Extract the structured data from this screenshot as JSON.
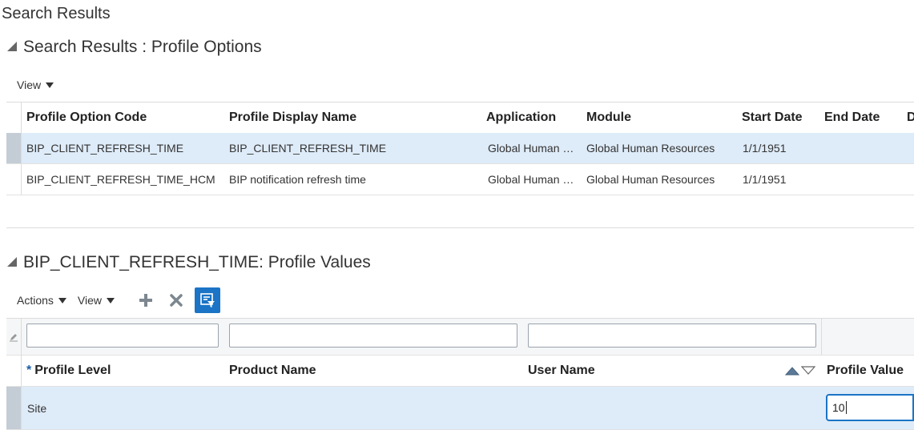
{
  "page": {
    "title": "Search Results"
  },
  "profile_options": {
    "section_title": "Search Results : Profile Options",
    "toolbar": {
      "view_label": "View"
    },
    "columns": [
      "Profile Option Code",
      "Profile Display Name",
      "Application",
      "Module",
      "Start Date",
      "End Date",
      "D"
    ],
    "rows": [
      {
        "code": "BIP_CLIENT_REFRESH_TIME",
        "display_name": "BIP_CLIENT_REFRESH_TIME",
        "application": "Global Human …",
        "module": "Global Human Resources",
        "start_date": "1/1/1951",
        "end_date": "",
        "selected": true
      },
      {
        "code": "BIP_CLIENT_REFRESH_TIME_HCM",
        "display_name": "BIP notification refresh time",
        "application": "Global Human …",
        "module": "Global Human Resources",
        "start_date": "1/1/1951",
        "end_date": "",
        "selected": false
      }
    ]
  },
  "profile_values": {
    "section_title": "BIP_CLIENT_REFRESH_TIME: Profile Values",
    "toolbar": {
      "actions_label": "Actions",
      "view_label": "View"
    },
    "filters": {
      "profile_level": "",
      "product_name": "",
      "user_name": ""
    },
    "columns": {
      "profile_level": "Profile Level",
      "product_name": "Product Name",
      "user_name": "User Name",
      "profile_value": "Profile Value"
    },
    "required_marker": "*",
    "rows": [
      {
        "profile_level": "Site",
        "product_name": "",
        "user_name": "",
        "profile_value": "10"
      }
    ]
  },
  "colors": {
    "accent": "#1b74c5",
    "selected_row": "#deebf8"
  }
}
